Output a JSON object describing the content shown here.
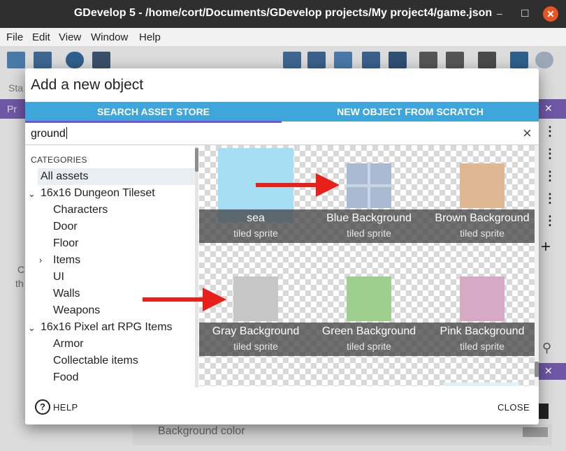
{
  "window": {
    "title": "GDevelop 5 - /home/cort/Documents/GDevelop projects/My project4/game.json",
    "minimize": "–",
    "maximize": "☐",
    "close": "✕"
  },
  "menu": [
    "File",
    "Edit",
    "View",
    "Window",
    "Help"
  ],
  "background": {
    "sta_fragment": "Sta",
    "pr_fragment": "Pr",
    "c_fragment": "C",
    "th_fragment": "th",
    "background_color_label": "Background color"
  },
  "dialog": {
    "title": "Add a new object",
    "tabs": [
      {
        "label": "SEARCH ASSET STORE",
        "active": true
      },
      {
        "label": "NEW OBJECT FROM SCRATCH",
        "active": false
      }
    ],
    "search": {
      "value": "ground",
      "clear_icon": "×"
    },
    "categories_header": "CATEGORIES",
    "categories": [
      {
        "label": "All assets",
        "selected": true
      },
      {
        "label": "16x16 Dungeon Tileset",
        "expanded": true
      },
      {
        "label": "Characters"
      },
      {
        "label": "Door"
      },
      {
        "label": "Floor"
      },
      {
        "label": "Items",
        "expandable": true
      },
      {
        "label": "UI"
      },
      {
        "label": "Walls"
      },
      {
        "label": "Weapons"
      },
      {
        "label": "16x16 Pixel art RPG Items",
        "expanded": true
      },
      {
        "label": "Armor"
      },
      {
        "label": "Collectable items"
      },
      {
        "label": "Food"
      }
    ],
    "assets": [
      {
        "name": "sea",
        "type": "tiled sprite",
        "color": "#a6dff4"
      },
      {
        "name": "Blue Background",
        "type": "tiled sprite",
        "color": "#a9bad2"
      },
      {
        "name": "Brown Background",
        "type": "tiled sprite",
        "color": "#dfb792"
      },
      {
        "name": "Gray Background",
        "type": "tiled sprite",
        "color": "#c6c6c6"
      },
      {
        "name": "Green Background",
        "type": "tiled sprite",
        "color": "#9dcf8f"
      },
      {
        "name": "Pink Background",
        "type": "tiled sprite",
        "color": "#d6a9c4"
      }
    ],
    "help_label": "HELP",
    "close_label": "CLOSE"
  }
}
